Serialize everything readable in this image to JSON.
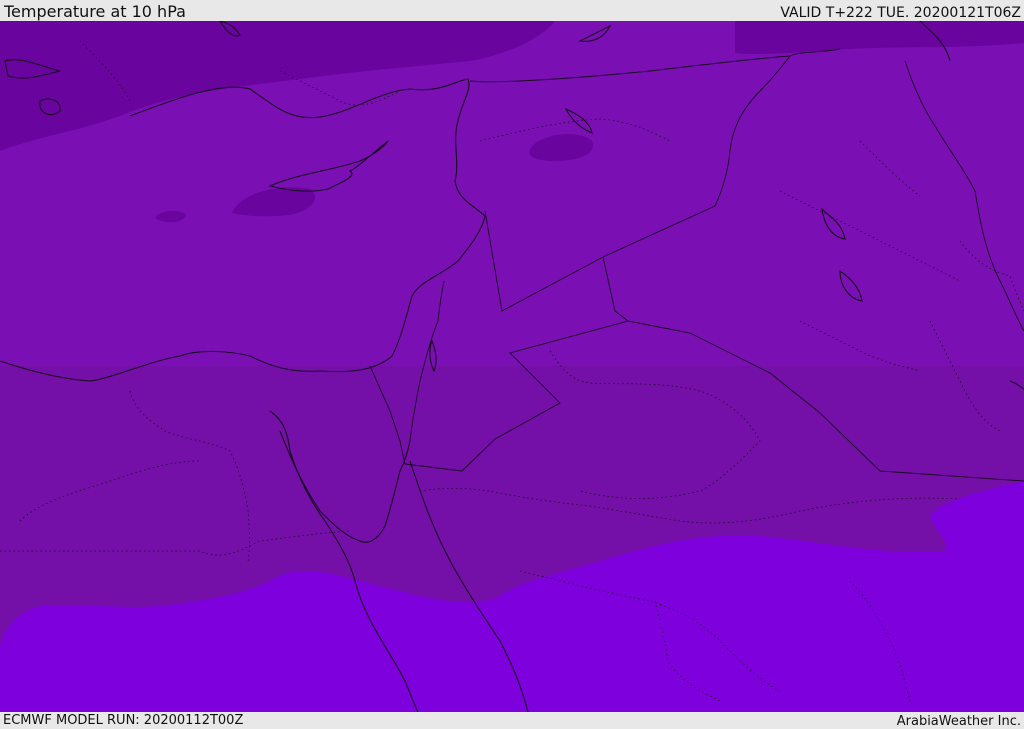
{
  "header": {
    "title": "Temperature at 10 hPa",
    "valid_label": "VALID T+222 TUE. 20200121T06Z"
  },
  "footer": {
    "model_run": "ECMWF MODEL RUN: 20200112T00Z",
    "credit": "ArabiaWeather Inc."
  },
  "map": {
    "colors": {
      "band_dark": "#6a049e",
      "band_main": "#7a10b4",
      "band_mid": "#7410a8",
      "band_light": "#7e00dc",
      "lines": "#1a0a22"
    }
  }
}
